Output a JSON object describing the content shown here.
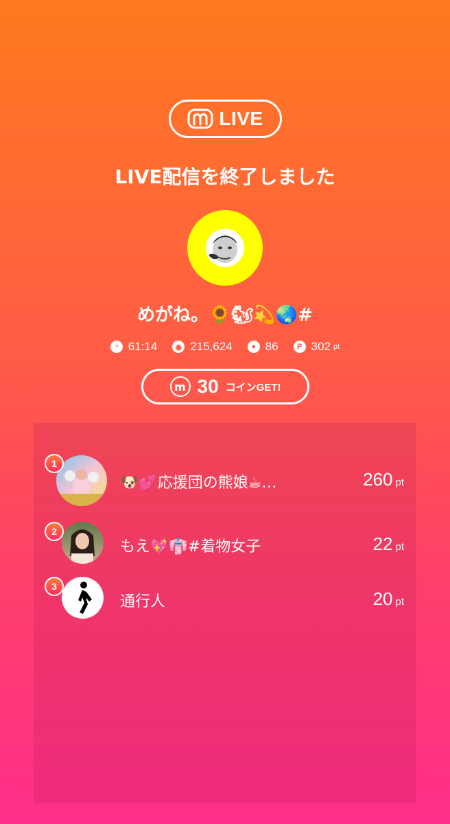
{
  "header": {
    "badge_logo": "m",
    "badge_label": "LIVE",
    "title": "LIVE配信を終了しました"
  },
  "streamer": {
    "name": "めがね。🌻🐿💫🌏#",
    "avatar_bg": "#ffff00"
  },
  "stats": {
    "duration": "61:14",
    "viewers": "215,624",
    "comments": "86",
    "points": "302",
    "points_unit": "pt"
  },
  "coin": {
    "logo": "m",
    "amount": "30",
    "label": "コインGET!"
  },
  "ranking": [
    {
      "rank": "1",
      "name": "🐶💕応援団の熊娘☕…",
      "points": "260",
      "unit": "pt"
    },
    {
      "rank": "2",
      "name": "もえ💖👘#着物女子",
      "points": "22",
      "unit": "pt"
    },
    {
      "rank": "3",
      "name": "通行人",
      "points": "20",
      "unit": "pt"
    }
  ]
}
